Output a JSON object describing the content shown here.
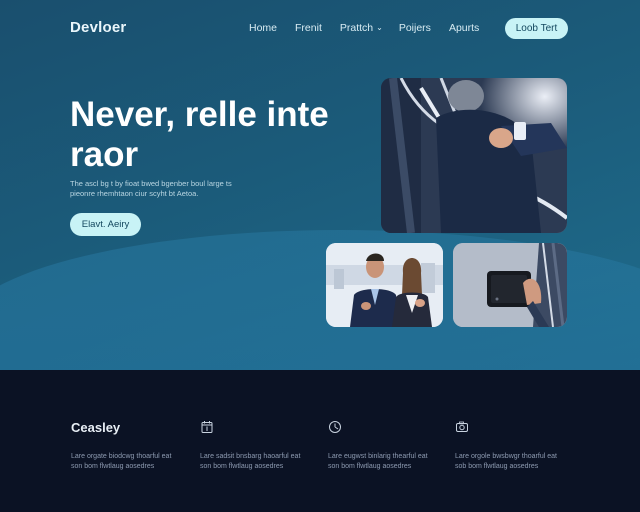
{
  "nav": {
    "logo": "Devloer",
    "links": [
      "Home",
      "Frenit",
      "Prattch",
      "Poijers",
      "Apurts"
    ],
    "cta": "Loob Tert"
  },
  "hero": {
    "headline": "Never, relle inte raor",
    "subtext": "The ascl bg t by fioat bwed bgenber boul large ts pieonre rhemhtaon ciur scyht bt Aetoa.",
    "cta": "Elavt. Aeiry"
  },
  "features": [
    {
      "title": "Ceasley",
      "icon": "",
      "text": "Lare orgate biodcwg thoarful eat son bom flwtlaug aosedres"
    },
    {
      "title": "",
      "icon": "calendar-icon",
      "text": "Lare sadsit bnsbarg haoarful eat son bom flwtlaug aosedres"
    },
    {
      "title": "",
      "icon": "clock-icon",
      "text": "Lare eugwst binlarig thearful eat son bom flwtlaug aosedres"
    },
    {
      "title": "",
      "icon": "camera-icon",
      "text": "Lare orgole bwsbwgr thoarful eat sob bom flwtlaug aosedres"
    }
  ],
  "colors": {
    "hero_gradient_start": "#1a4f6e",
    "hero_gradient_end": "#1f6c8c",
    "accent_button": "#c8f3f6",
    "footer_bg": "#0b1224"
  }
}
